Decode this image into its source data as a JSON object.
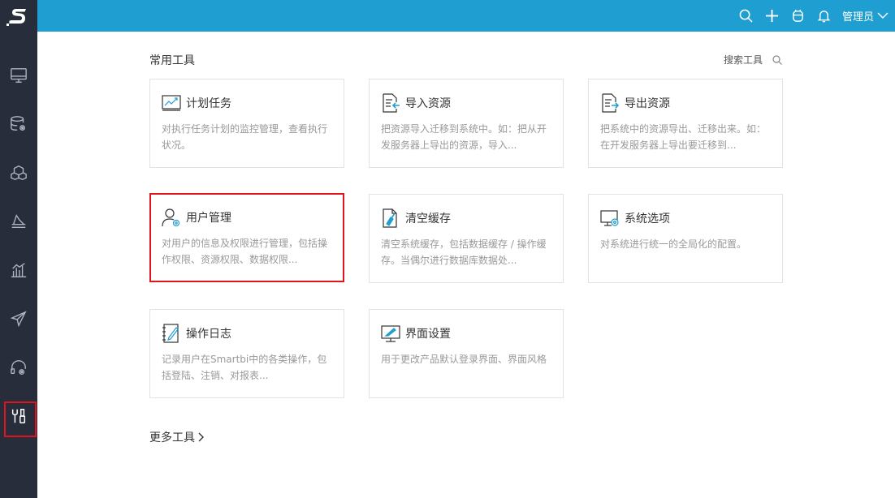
{
  "app": {
    "logo": "S"
  },
  "sidebar": {
    "items": [
      {
        "name": "monitor",
        "icon": "monitor-icon"
      },
      {
        "name": "database",
        "icon": "database-gear-icon"
      },
      {
        "name": "cubes",
        "icon": "cubes-icon"
      },
      {
        "name": "layers",
        "icon": "layers-icon"
      },
      {
        "name": "chart",
        "icon": "bar-chart-icon"
      },
      {
        "name": "send",
        "icon": "paper-plane-icon"
      },
      {
        "name": "support",
        "icon": "headset-gear-icon"
      },
      {
        "name": "tools",
        "icon": "tools-icon",
        "active": true
      }
    ]
  },
  "topbar": {
    "user": "管理员"
  },
  "main": {
    "section_title": "常用工具",
    "search_label": "搜索工具",
    "more_label": "更多工具",
    "cards": [
      {
        "title": "计划任务",
        "desc": "对执行任务计划的监控管理，查看执行状况。",
        "icon": "schedule-chart-icon"
      },
      {
        "title": "导入资源",
        "desc": "把资源导入迁移到系统中。如：把从开发服务器上导出的资源，导入...",
        "icon": "import-document-icon"
      },
      {
        "title": "导出资源",
        "desc": "把系统中的资源导出、迁移出来。如：在开发服务器上导出要迁移到...",
        "icon": "export-document-icon"
      },
      {
        "title": "用户管理",
        "desc": "对用户的信息及权限进行管理，包括操作权限、资源权限、数据权限...",
        "icon": "user-gear-icon",
        "highlight": true
      },
      {
        "title": "清空缓存",
        "desc": "清空系统缓存，包括数据缓存 / 操作缓存。当偶尔进行数据库数据处...",
        "icon": "clear-cache-icon"
      },
      {
        "title": "系统选项",
        "desc": "对系统进行统一的全局化的配置。",
        "icon": "system-settings-icon"
      },
      {
        "title": "操作日志",
        "desc": "记录用户在Smartbi中的各类操作，包括登陆、注销、对报表...",
        "icon": "log-notebook-icon"
      },
      {
        "title": "界面设置",
        "desc": "用于更改产品默认登录界面、界面风格",
        "icon": "screen-brush-icon"
      }
    ]
  },
  "colors": {
    "sidebar": "#282d3c",
    "topbar": "#1f9fd1",
    "highlight": "#e0141e",
    "accent": "#1f9fd1"
  }
}
